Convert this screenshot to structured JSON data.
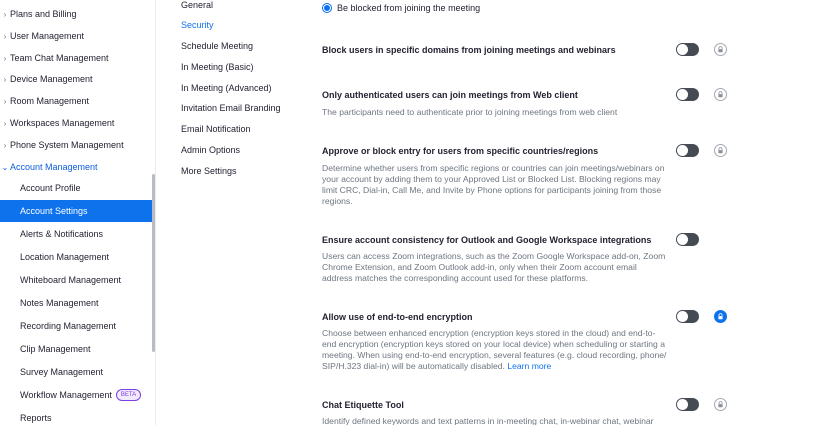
{
  "left_nav": {
    "groups": [
      {
        "label": "Plans and Billing",
        "icon": "chevron-right-icon"
      },
      {
        "label": "User Management",
        "icon": "chevron-right-icon"
      },
      {
        "label": "Team Chat Management",
        "icon": "chevron-right-icon"
      },
      {
        "label": "Device Management",
        "icon": "chevron-right-icon"
      },
      {
        "label": "Room Management",
        "icon": "chevron-right-icon"
      },
      {
        "label": "Workspaces Management",
        "icon": "chevron-right-icon"
      },
      {
        "label": "Phone System Management",
        "icon": "chevron-right-icon"
      },
      {
        "label": "Account Management",
        "icon": "chevron-down-icon"
      }
    ],
    "account_items": [
      {
        "label": "Account Profile"
      },
      {
        "label": "Account Settings"
      },
      {
        "label": "Alerts & Notifications"
      },
      {
        "label": "Location Management"
      },
      {
        "label": "Whiteboard Management"
      },
      {
        "label": "Notes Management"
      },
      {
        "label": "Recording Management"
      },
      {
        "label": "Clip Management"
      },
      {
        "label": "Survey Management"
      },
      {
        "label": "Workflow Management",
        "badge": "BETA"
      },
      {
        "label": "Reports"
      }
    ]
  },
  "mid_nav": {
    "items": [
      "General",
      "Security",
      "Schedule Meeting",
      "In Meeting (Basic)",
      "In Meeting (Advanced)",
      "Invitation Email Branding",
      "Email Notification",
      "Admin Options",
      "More Settings"
    ],
    "active": "Security"
  },
  "main": {
    "radio_label": "Be blocked from joining the meeting",
    "settings": [
      {
        "title": "Block users in specific domains from joining meetings and webinars",
        "desc": "",
        "toggle": "off",
        "lock": "unlocked"
      },
      {
        "title": "Only authenticated users can join meetings from Web client",
        "desc": "The participants need to authenticate prior to joining meetings from web client",
        "toggle": "off",
        "lock": "unlocked"
      },
      {
        "title": "Approve or block entry for users from specific countries/regions",
        "desc": "Determine whether users from specific regions or countries can join meetings/webinars on your account by adding them to your Approved List or Blocked List. Blocking regions may limit CRC, Dial-in, Call Me, and Invite by Phone options for participants joining from those regions.",
        "toggle": "off",
        "lock": "unlocked"
      },
      {
        "title": "Ensure account consistency for Outlook and Google Workspace integrations",
        "desc": "Users can access Zoom integrations, such as the Zoom Google Workspace add-on, Zoom Chrome Extension, and Zoom Outlook add-in, only when their Zoom account email address matches the corresponding account used for these platforms.",
        "toggle": "off",
        "lock": "none"
      },
      {
        "title": "Allow use of end-to-end encryption",
        "desc": "Choose between enhanced encryption (encryption keys stored in the cloud) and end-to-end encryption (encryption keys stored on your local device) when scheduling or starting a meeting. When using end-to-end encryption, several features (e.g. cloud recording, phone/ SIP/H.323 dial-in) will be automatically disabled.",
        "link": "Learn more",
        "toggle": "off",
        "lock": "locked"
      },
      {
        "title": "Chat Etiquette Tool",
        "desc": "Identify defined keywords and text patterns in in-meeting chat, in-webinar chat, webinar",
        "toggle": "off",
        "lock": "unlocked"
      }
    ]
  },
  "colors": {
    "accent": "#0e72ed",
    "toggle_off": "#444b53",
    "text": "#232333",
    "muted": "#6e7680"
  }
}
